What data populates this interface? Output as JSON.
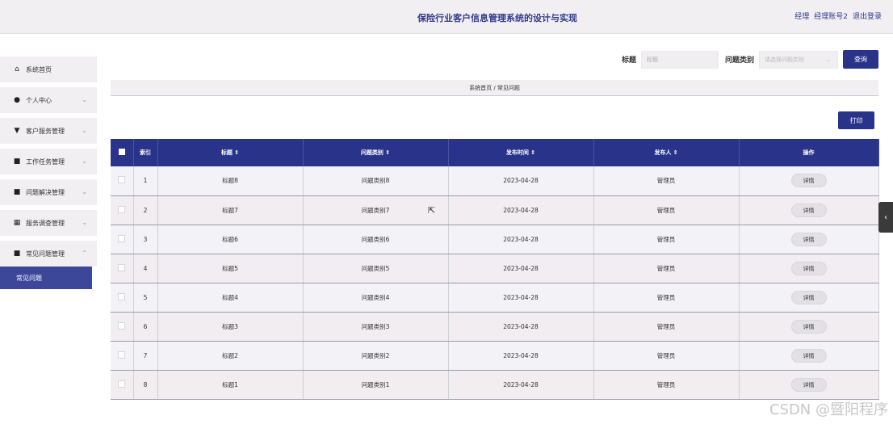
{
  "header": {
    "title": "保险行业客户信息管理系统的设计与实现",
    "role": "经理",
    "account": "经理账号2",
    "logout": "退出登录"
  },
  "sidebar": {
    "items": [
      {
        "label": "系统首页",
        "icon": "home-icon",
        "glyph": "⌂",
        "expandable": false
      },
      {
        "label": "个人中心",
        "icon": "person-icon",
        "glyph": "●",
        "expandable": true
      },
      {
        "label": "客户服务管理",
        "icon": "service-icon",
        "glyph": "▼",
        "expandable": true
      },
      {
        "label": "工作任务管理",
        "icon": "task-icon",
        "glyph": "■",
        "expandable": true
      },
      {
        "label": "问题解决管理",
        "icon": "issue-icon",
        "glyph": "■",
        "expandable": true
      },
      {
        "label": "服务调查管理",
        "icon": "grid-icon",
        "glyph": "▦",
        "expandable": true
      },
      {
        "label": "常见问题管理",
        "icon": "faq-icon",
        "glyph": "■",
        "expandable": true,
        "expanded": true
      }
    ],
    "submenu": {
      "label": "常见问题",
      "active": true
    }
  },
  "search": {
    "title_label": "标题",
    "title_placeholder": "标题",
    "type_label": "问题类别",
    "type_placeholder": "请选择问题类别",
    "query_button": "查询"
  },
  "breadcrumb": {
    "home": "系统首页",
    "separator": "/",
    "current": "常见问题"
  },
  "toolbar": {
    "print_button": "打印"
  },
  "table": {
    "columns": [
      "索引",
      "标题 ⇕",
      "问题类别 ⇕",
      "发布时间 ⇕",
      "发布人 ⇕",
      "操作"
    ],
    "rows": [
      {
        "index": "1",
        "title": "标题8",
        "category": "问题类别8",
        "date": "2023-04-28",
        "publisher": "管理员",
        "action": "详情"
      },
      {
        "index": "2",
        "title": "标题7",
        "category": "问题类别7",
        "date": "2023-04-28",
        "publisher": "管理员",
        "action": "详情"
      },
      {
        "index": "3",
        "title": "标题6",
        "category": "问题类别6",
        "date": "2023-04-28",
        "publisher": "管理员",
        "action": "详情"
      },
      {
        "index": "4",
        "title": "标题5",
        "category": "问题类别5",
        "date": "2023-04-28",
        "publisher": "管理员",
        "action": "详情"
      },
      {
        "index": "5",
        "title": "标题4",
        "category": "问题类别4",
        "date": "2023-04-28",
        "publisher": "管理员",
        "action": "详情"
      },
      {
        "index": "6",
        "title": "标题3",
        "category": "问题类别3",
        "date": "2023-04-28",
        "publisher": "管理员",
        "action": "详情"
      },
      {
        "index": "7",
        "title": "标题2",
        "category": "问题类别2",
        "date": "2023-04-28",
        "publisher": "管理员",
        "action": "详情"
      },
      {
        "index": "8",
        "title": "标题1",
        "category": "问题类别1",
        "date": "2023-04-28",
        "publisher": "管理员",
        "action": "详情"
      }
    ]
  },
  "watermark": "CSDN @暨阳程序",
  "colors": {
    "primary": "#29338a",
    "header_bg": "#f2eff3",
    "active_menu": "#3c4799"
  }
}
